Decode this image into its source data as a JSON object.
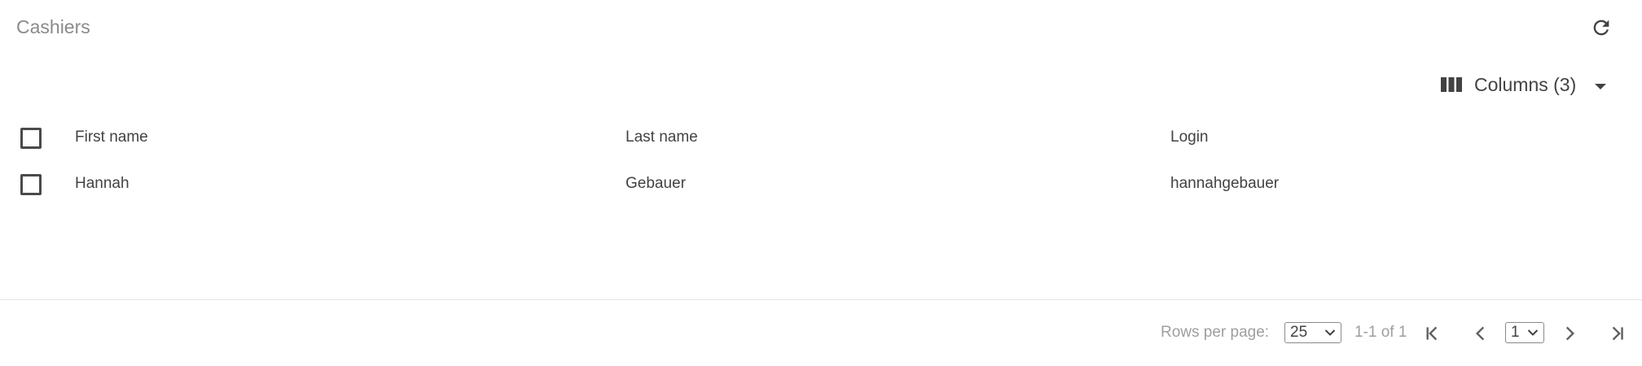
{
  "header": {
    "title": "Cashiers",
    "refresh_icon": "refresh-icon"
  },
  "toolbar": {
    "columns_label": "Columns (3)",
    "columns_icon": "view-column-icon"
  },
  "table": {
    "columns": [
      "First name",
      "Last name",
      "Login"
    ],
    "rows": [
      {
        "first_name": "Hannah",
        "last_name": "Gebauer",
        "login": "hannahgebauer"
      }
    ]
  },
  "pagination": {
    "rows_per_page_label": "Rows per page:",
    "rows_per_page_value": "25",
    "range_label": "1-1 of 1",
    "page_value": "1"
  }
}
